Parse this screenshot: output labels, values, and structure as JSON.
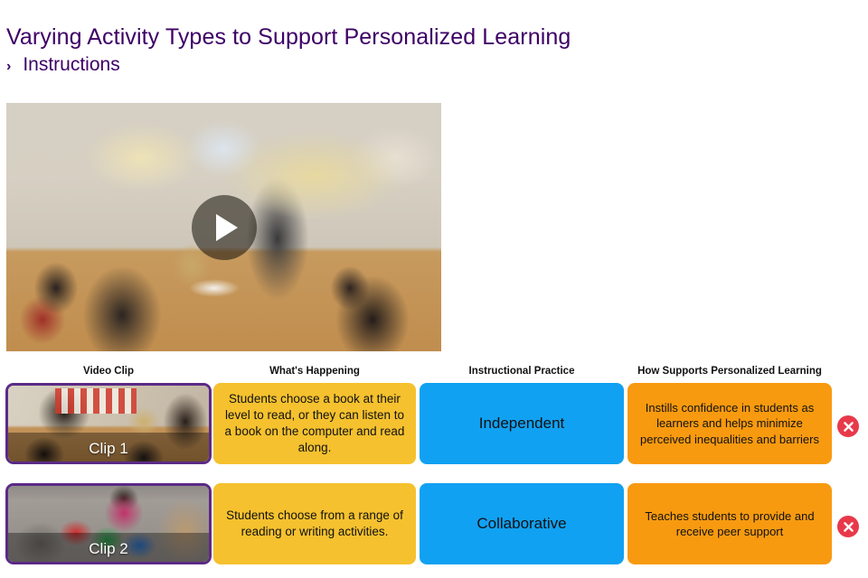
{
  "header": {
    "title": "Varying Activity Types to Support Personalized Learning",
    "instructions_label": "Instructions",
    "chevron": "›"
  },
  "video": {
    "play_label": "Play",
    "alt": "Teacher and students seated around a classroom table with books"
  },
  "table": {
    "columns": [
      {
        "key": "video_clip",
        "label": "Video Clip"
      },
      {
        "key": "whats_happening",
        "label": "What's Happening"
      },
      {
        "key": "instructional_practice",
        "label": "Instructional Practice"
      },
      {
        "key": "how_supports",
        "label": "How Supports Personalized Learning"
      }
    ],
    "rows": [
      {
        "clip_label": "Clip 1",
        "whats_happening": "Students choose a book at their level to read, or they can listen to a book on the computer and read along.",
        "instructional_practice": "Independent",
        "how_supports": "Instills confidence in students as learners and helps minimize perceived inequalities and barriers",
        "remove_label": "×"
      },
      {
        "clip_label": "Clip 2",
        "whats_happening": "Students choose from a range of reading or writing activities.",
        "instructional_practice": "Collaborative",
        "how_supports": "Teaches students to provide and receive peer support",
        "remove_label": "×"
      }
    ]
  },
  "colors": {
    "title_purple": "#3d0066",
    "thumb_border_purple": "#5b2a86",
    "whats_happening_yellow": "#f5c12e",
    "instructional_practice_blue": "#11a1f2",
    "how_supports_orange": "#f89a10",
    "remove_red": "#e8394a",
    "page_background": "#ffffff"
  }
}
